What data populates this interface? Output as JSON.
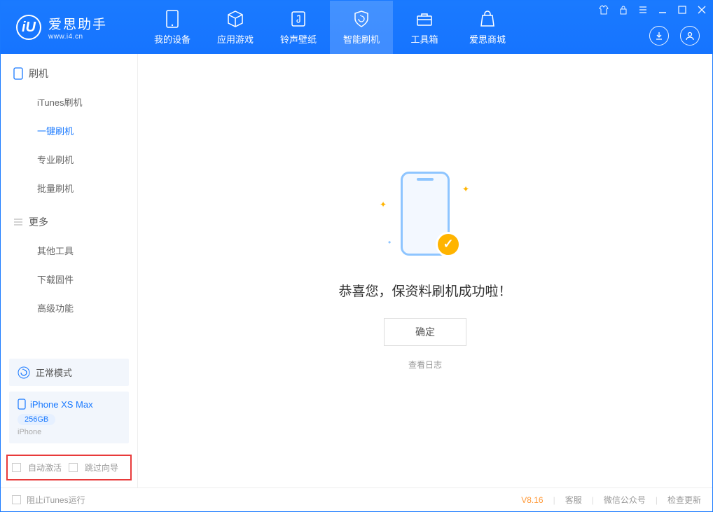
{
  "app": {
    "name": "爱思助手",
    "url": "www.i4.cn",
    "logo_letter": "iU"
  },
  "nav": {
    "tabs": [
      {
        "label": "我的设备"
      },
      {
        "label": "应用游戏"
      },
      {
        "label": "铃声壁纸"
      },
      {
        "label": "智能刷机"
      },
      {
        "label": "工具箱"
      },
      {
        "label": "爱思商城"
      }
    ],
    "active_index": 3
  },
  "sidebar": {
    "sections": [
      {
        "title": "刷机",
        "items": [
          "iTunes刷机",
          "一键刷机",
          "专业刷机",
          "批量刷机"
        ],
        "active_index": 1
      },
      {
        "title": "更多",
        "items": [
          "其他工具",
          "下载固件",
          "高级功能"
        ],
        "active_index": -1
      }
    ],
    "mode": {
      "label": "正常模式"
    },
    "device": {
      "name": "iPhone XS Max",
      "storage": "256GB",
      "type": "iPhone"
    },
    "bottom_opts": {
      "auto_activate": "自动激活",
      "skip_guide": "跳过向导"
    }
  },
  "main": {
    "success_message": "恭喜您，保资料刷机成功啦！",
    "ok_button": "确定",
    "view_log": "查看日志"
  },
  "statusbar": {
    "block_itunes": "阻止iTunes运行",
    "version": "V8.16",
    "links": [
      "客服",
      "微信公众号",
      "检查更新"
    ]
  }
}
